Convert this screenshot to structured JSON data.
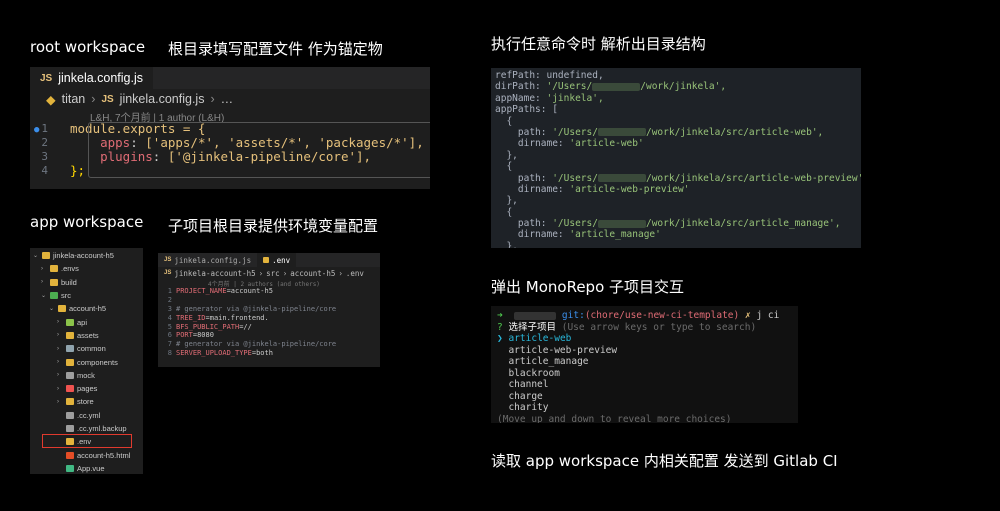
{
  "headings": {
    "root_workspace": "root workspace",
    "root_desc": "根目录填写配置文件 作为锚定物",
    "app_workspace": "app workspace",
    "app_desc": "子项目根目录提供环境变量配置",
    "run_command": "执行任意命令时 解析出目录结构",
    "monorepo": "弹出 MonoRepo 子项目交互",
    "read_config": "读取 app workspace 内相关配置 发送到 Gitlab CI"
  },
  "root_editor": {
    "tab_label": "jinkela.config.js",
    "crumb_root": "titan",
    "crumb_file": "jinkela.config.js",
    "crumb_more": "…",
    "blame": "L&H, 7个月前 | 1 author (L&H)",
    "lines": [
      {
        "n": "1",
        "text": "module.exports = {"
      },
      {
        "n": "2",
        "key": "apps",
        "value": "['apps/*', 'assets/*', 'packages/*'],"
      },
      {
        "n": "3",
        "key": "plugins",
        "value": "['@jinkela-pipeline/core'],"
      },
      {
        "n": "4",
        "text": "};"
      }
    ]
  },
  "file_tree": {
    "items": [
      {
        "label": "jinkela-account-h5",
        "icon": "folder-open-icon",
        "color": "#e2b33c",
        "indent": 0,
        "chev": "⌄"
      },
      {
        "label": ".envs",
        "icon": "folder-icon",
        "color": "#e2b33c",
        "indent": 1,
        "chev": "›"
      },
      {
        "label": "build",
        "icon": "folder-icon",
        "color": "#e2b33c",
        "indent": 1,
        "chev": "›"
      },
      {
        "label": "src",
        "icon": "folder-open-icon",
        "color": "#4caf50",
        "indent": 1,
        "chev": "⌄"
      },
      {
        "label": "account-h5",
        "icon": "folder-open-icon",
        "color": "#e2b33c",
        "indent": 2,
        "chev": "⌄"
      },
      {
        "label": "api",
        "icon": "folder-icon",
        "color": "#8bc34a",
        "indent": 3,
        "chev": "›"
      },
      {
        "label": "assets",
        "icon": "folder-icon",
        "color": "#e2b33c",
        "indent": 3,
        "chev": "›"
      },
      {
        "label": "common",
        "icon": "folder-icon",
        "color": "#90a4ae",
        "indent": 3,
        "chev": "›"
      },
      {
        "label": "components",
        "icon": "folder-icon",
        "color": "#e2b33c",
        "indent": 3,
        "chev": "›"
      },
      {
        "label": "mock",
        "icon": "folder-icon",
        "color": "#9e9e9e",
        "indent": 3,
        "chev": "›"
      },
      {
        "label": "pages",
        "icon": "folder-icon",
        "color": "#ef5350",
        "indent": 3,
        "chev": "›"
      },
      {
        "label": "store",
        "icon": "folder-icon",
        "color": "#e2b33c",
        "indent": 3,
        "chev": "›"
      },
      {
        "label": ".cc.yml",
        "icon": "file-icon",
        "color": "#9e9e9e",
        "indent": 3,
        "chev": ""
      },
      {
        "label": ".cc.yml.backup",
        "icon": "file-icon",
        "color": "#9e9e9e",
        "indent": 3,
        "chev": ""
      },
      {
        "label": ".env",
        "icon": "env-file-icon",
        "color": "#e2b33c",
        "indent": 3,
        "chev": ""
      },
      {
        "label": "account-h5.html",
        "icon": "html-file-icon",
        "color": "#e44d26",
        "indent": 3,
        "chev": ""
      },
      {
        "label": "App.vue",
        "icon": "vue-file-icon",
        "color": "#41b883",
        "indent": 3,
        "chev": ""
      }
    ]
  },
  "env_editor": {
    "tab1": "jinkela.config.js",
    "tab2": ".env",
    "crumb": [
      "jinkela-account-h5",
      "src",
      "account-h5",
      ".env"
    ],
    "blame": "4个月前 | 2 authors (and others)",
    "lines": [
      {
        "n": "1",
        "key": "PROJECT_NAME",
        "value": "=account-h5"
      },
      {
        "n": "2",
        "text": ""
      },
      {
        "n": "3",
        "comment": "# generator via @jinkela-pipeline/core"
      },
      {
        "n": "4",
        "key": "TREE_ID",
        "value": "=main.frontend."
      },
      {
        "n": "5",
        "key": "BFS_PUBLIC_PATH",
        "value": "=//"
      },
      {
        "n": "6",
        "key": "PORT",
        "value": "=8080"
      },
      {
        "n": "7",
        "comment": "# generator via @jinkela-pipeline/core"
      },
      {
        "n": "8",
        "key": "SERVER_UPLOAD_TYPE",
        "value": "=both"
      }
    ]
  },
  "parsed": {
    "lines": [
      {
        "pre": "refPath: undefined,",
        "str": ""
      },
      {
        "pre": "dirPath: ",
        "str": "'/Users/",
        "blur": true,
        "post": "/work/jinkela',"
      },
      {
        "pre": "appName: ",
        "str": "'jinkela',"
      },
      {
        "pre": "appPaths: [",
        "str": ""
      },
      {
        "pre": "  {",
        "str": ""
      },
      {
        "pre": "    path: ",
        "str": "'/Users/",
        "blur": true,
        "post": "/work/jinkela/src/article-web',"
      },
      {
        "pre": "    dirname: ",
        "str": "'article-web'"
      },
      {
        "pre": "  },",
        "str": ""
      },
      {
        "pre": "  {",
        "str": ""
      },
      {
        "pre": "    path: ",
        "str": "'/Users/",
        "blur": true,
        "post": "/work/jinkela/src/article-web-preview',"
      },
      {
        "pre": "    dirname: ",
        "str": "'article-web-preview'"
      },
      {
        "pre": "  },",
        "str": ""
      },
      {
        "pre": "  {",
        "str": ""
      },
      {
        "pre": "    path: ",
        "str": "'/Users/",
        "blur": true,
        "post": "/work/jinkela/src/article_manage',"
      },
      {
        "pre": "    dirname: ",
        "str": "'article_manage'"
      },
      {
        "pre": "  },",
        "str": ""
      },
      {
        "pre": "  {",
        "str": ""
      }
    ]
  },
  "terminal": {
    "prompt_arrow": "➜",
    "git_label": "git:",
    "branch": "(chore/use-new-ci-template)",
    "cross": "✗",
    "command": "j ci",
    "question_mark": "?",
    "question": "选择子项目",
    "hint": "(Use arrow keys or type to search)",
    "pointer": "❯",
    "choices": [
      "article-web",
      "article-web-preview",
      "article_manage",
      "blackroom",
      "channel",
      "charge",
      "charity"
    ],
    "footer": "(Move up and down to reveal more choices)"
  }
}
